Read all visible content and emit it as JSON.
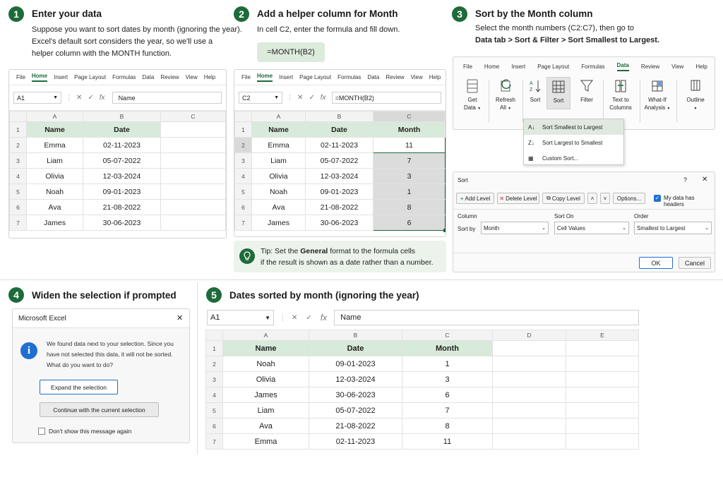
{
  "step1": {
    "num": "1",
    "title": "Enter your data",
    "desc": [
      "Suppose you want to sort dates by month (ignoring the year).",
      "Excel's default sort considers the year, so we'll use a",
      "helper column with the MONTH function."
    ],
    "ribbon": [
      "File",
      "Home",
      "Insert",
      "Page Layout",
      "Formulas",
      "Data",
      "Review",
      "View",
      "Help"
    ],
    "namebox": "A1",
    "formula": "Name",
    "cols": [
      "A",
      "B",
      "C"
    ],
    "headers": [
      "Name",
      "Date"
    ],
    "rows": [
      [
        "Emma",
        "02-11-2023"
      ],
      [
        "Liam",
        "05-07-2022"
      ],
      [
        "Olivia",
        "12-03-2024"
      ],
      [
        "Noah",
        "09-01-2023"
      ],
      [
        "Ava",
        "21-08-2022"
      ],
      [
        "James",
        "30-06-2023"
      ]
    ]
  },
  "step2": {
    "num": "2",
    "title": "Add a helper column for Month",
    "desc": "In cell C2, enter the formula and fill down.",
    "formula_chip": "=MONTH(B2)",
    "ribbon": [
      "File",
      "Home",
      "Insert",
      "Page Layout",
      "Formulas",
      "Data",
      "Review",
      "View",
      "Help"
    ],
    "namebox": "C2",
    "formula": "=MONTH(B2)",
    "cols": [
      "A",
      "B",
      "C"
    ],
    "headers": [
      "Name",
      "Date",
      "Month"
    ],
    "rows": [
      [
        "Emma",
        "02-11-2023",
        "11"
      ],
      [
        "Liam",
        "05-07-2022",
        "7"
      ],
      [
        "Olivia",
        "12-03-2024",
        "3"
      ],
      [
        "Noah",
        "09-01-2023",
        "1"
      ],
      [
        "Ava",
        "21-08-2022",
        "8"
      ],
      [
        "James",
        "30-06-2023",
        "6"
      ]
    ],
    "tip_prefix": "Tip: Set the ",
    "tip_bold": "General",
    "tip_suffix": " format to the formula cells",
    "tip_line2": "if the result is shown as a date rather than a number."
  },
  "step3": {
    "num": "3",
    "title": "Sort by the Month column",
    "desc1": "Select the month numbers (C2:C7), then go to",
    "desc2": "Data tab > Sort & Filter > Sort Smallest to Largest.",
    "ribbon": [
      "File",
      "Home",
      "Insert",
      "Page Layout",
      "Formulas",
      "Data",
      "Review",
      "View",
      "Help"
    ],
    "tools": {
      "get_data": "Get",
      "get_data2": "Data",
      "refresh": "Refresh",
      "refresh2": "All",
      "sort_small": "Sort",
      "sort": "Sort",
      "filter": "Filter",
      "text_cols": "Text to",
      "text_cols2": "Columns",
      "whatif": "What-If",
      "whatif2": "Analysis",
      "outline": "Outline"
    },
    "menu": [
      "Sort Smallest to Largest",
      "Sort Largest to Smallest",
      "Custom Sort..."
    ],
    "dialog": {
      "title": "Sort",
      "help": "?",
      "add_level": "Add Level",
      "delete_level": "Delete Level",
      "copy_level": "Copy Level",
      "options": "Options...",
      "has_headers": "My data has headers",
      "col_header": "Column",
      "sorton_header": "Sort On",
      "order_header": "Order",
      "sort_by": "Sort by",
      "column_value": "Month",
      "sorton_value": "Cell Values",
      "order_value": "Smallest to Largest",
      "ok": "OK",
      "cancel": "Cancel"
    }
  },
  "step4": {
    "num": "4",
    "title": "Widen the selection if prompted",
    "dialog_title": "Microsoft Excel",
    "message": [
      "We found data next to your selection. Since you",
      "have not selected this data, it will not be sorted.",
      "What do you want to do?"
    ],
    "expand": "Expand the selection",
    "continue": "Continue with the current selection",
    "dont_show": "Don't show this message again"
  },
  "step5": {
    "num": "5",
    "title": "Dates sorted by month (ignoring the year)",
    "namebox": "A1",
    "formula": "Name",
    "cols": [
      "A",
      "B",
      "C",
      "D",
      "E"
    ],
    "headers": [
      "Name",
      "Date",
      "Month"
    ],
    "rows": [
      [
        "Noah",
        "09-01-2023",
        "1"
      ],
      [
        "Olivia",
        "12-03-2024",
        "3"
      ],
      [
        "James",
        "30-06-2023",
        "6"
      ],
      [
        "Liam",
        "05-07-2022",
        "7"
      ],
      [
        "Ava",
        "21-08-2022",
        "8"
      ],
      [
        "Emma",
        "02-11-2023",
        "11"
      ]
    ]
  },
  "colors": {
    "accent": "#1e6b3a",
    "header_fill": "#d8ead9",
    "selection_fill": "#dcdcdc",
    "info_blue": "#1f6fd0"
  }
}
